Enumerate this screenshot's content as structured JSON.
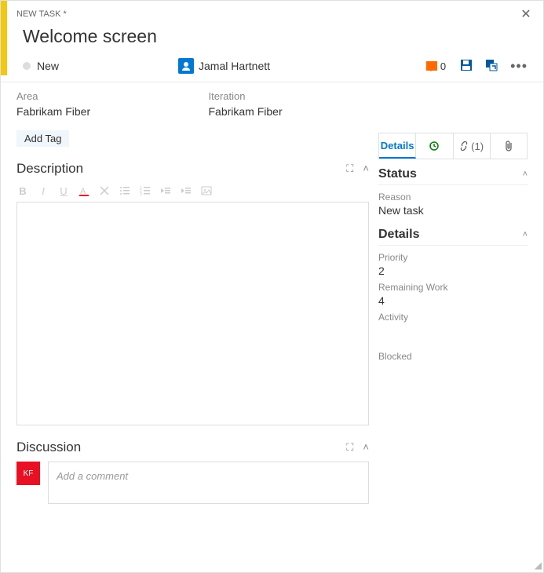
{
  "header": {
    "badge": "NEW TASK *",
    "title": "Welcome screen",
    "state": "New",
    "assignee": "Jamal Hartnett",
    "comments_count": "0"
  },
  "fields": {
    "area_label": "Area",
    "area_value": "Fabrikam Fiber",
    "iteration_label": "Iteration",
    "iteration_value": "Fabrikam Fiber",
    "add_tag": "Add Tag"
  },
  "description": {
    "title": "Description"
  },
  "discussion": {
    "title": "Discussion",
    "placeholder": "Add a comment",
    "avatar_initials": "KF"
  },
  "tabs": {
    "details": "Details",
    "links_count": "(1)"
  },
  "status_panel": {
    "title": "Status",
    "reason_label": "Reason",
    "reason_value": "New task"
  },
  "details_panel": {
    "title": "Details",
    "priority_label": "Priority",
    "priority_value": "2",
    "remaining_label": "Remaining Work",
    "remaining_value": "4",
    "activity_label": "Activity",
    "blocked_label": "Blocked"
  }
}
